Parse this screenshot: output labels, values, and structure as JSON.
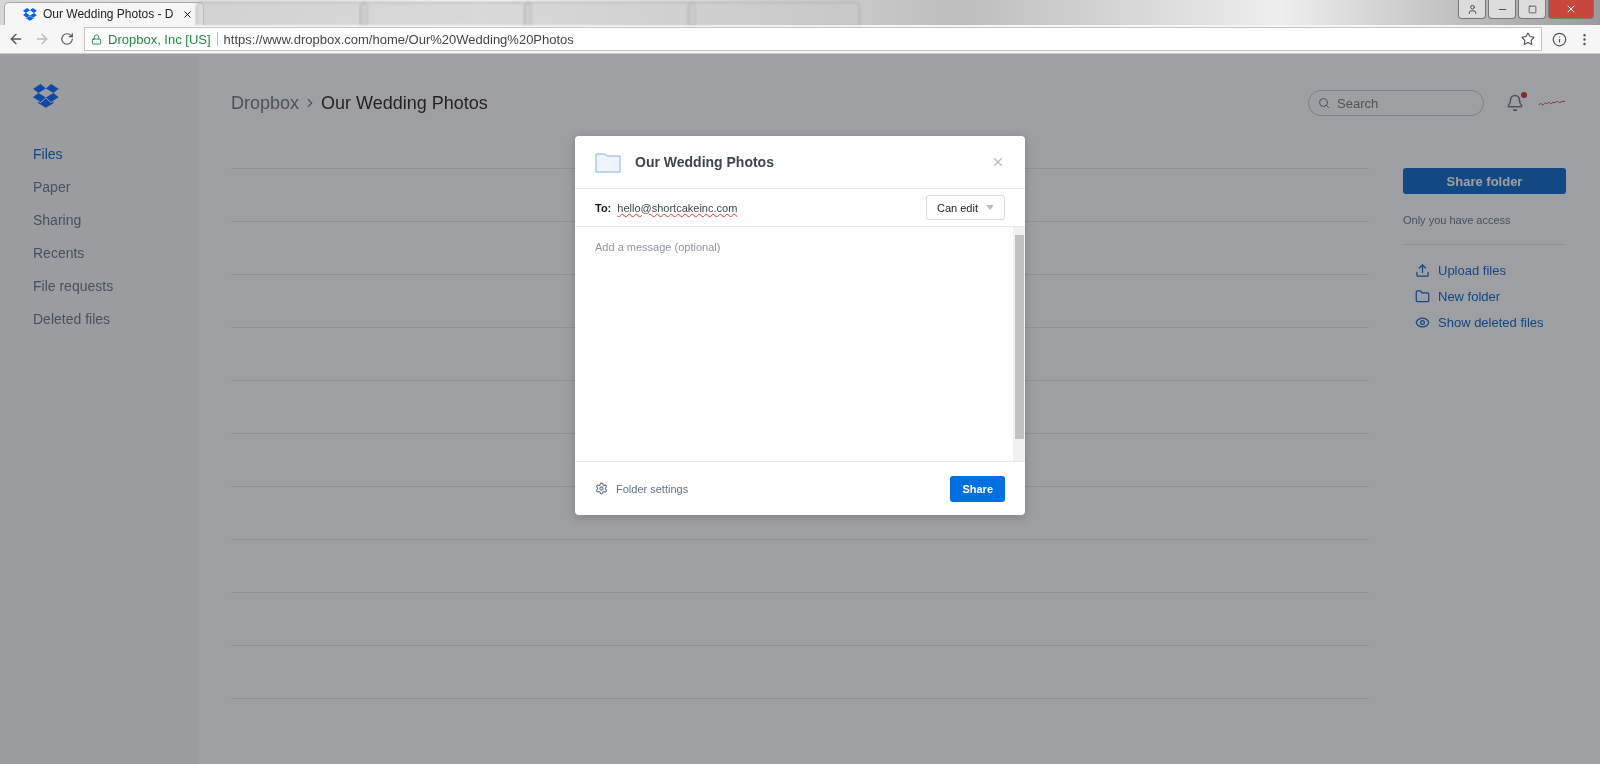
{
  "browser": {
    "tabs": [
      {
        "title": "Our Wedding Photos - D",
        "selected": true
      },
      {
        "selected": false
      },
      {
        "selected": false
      },
      {
        "selected": false
      },
      {
        "selected": false
      }
    ],
    "secure_label": "Dropbox, Inc [US]",
    "url": "https://www.dropbox.com/home/Our%20Wedding%20Photos"
  },
  "sidebar": {
    "items": [
      {
        "label": "Files",
        "selected": true
      },
      {
        "label": "Paper",
        "selected": false
      },
      {
        "label": "Sharing",
        "selected": false
      },
      {
        "label": "Recents",
        "selected": false
      },
      {
        "label": "File requests",
        "selected": false
      },
      {
        "label": "Deleted files",
        "selected": false
      }
    ]
  },
  "header": {
    "breadcrumb": [
      "Dropbox",
      "Our Wedding Photos"
    ],
    "search": {
      "placeholder": "Search"
    },
    "has_notification": true
  },
  "right_panel": {
    "share_button": "Share folder",
    "access_note": "Only you have access",
    "actions": [
      {
        "kind": "upload",
        "label": "Upload files"
      },
      {
        "kind": "folder",
        "label": "New folder"
      },
      {
        "kind": "eye",
        "label": "Show deleted files"
      }
    ]
  },
  "dialog": {
    "title": "Our Wedding Photos",
    "to_label": "To:",
    "recipient": "hello@shortcakeinc.com",
    "permission": "Can edit",
    "message": {
      "placeholder": "Add a message (optional)"
    },
    "settings_link": "Folder settings",
    "share_button": "Share"
  }
}
